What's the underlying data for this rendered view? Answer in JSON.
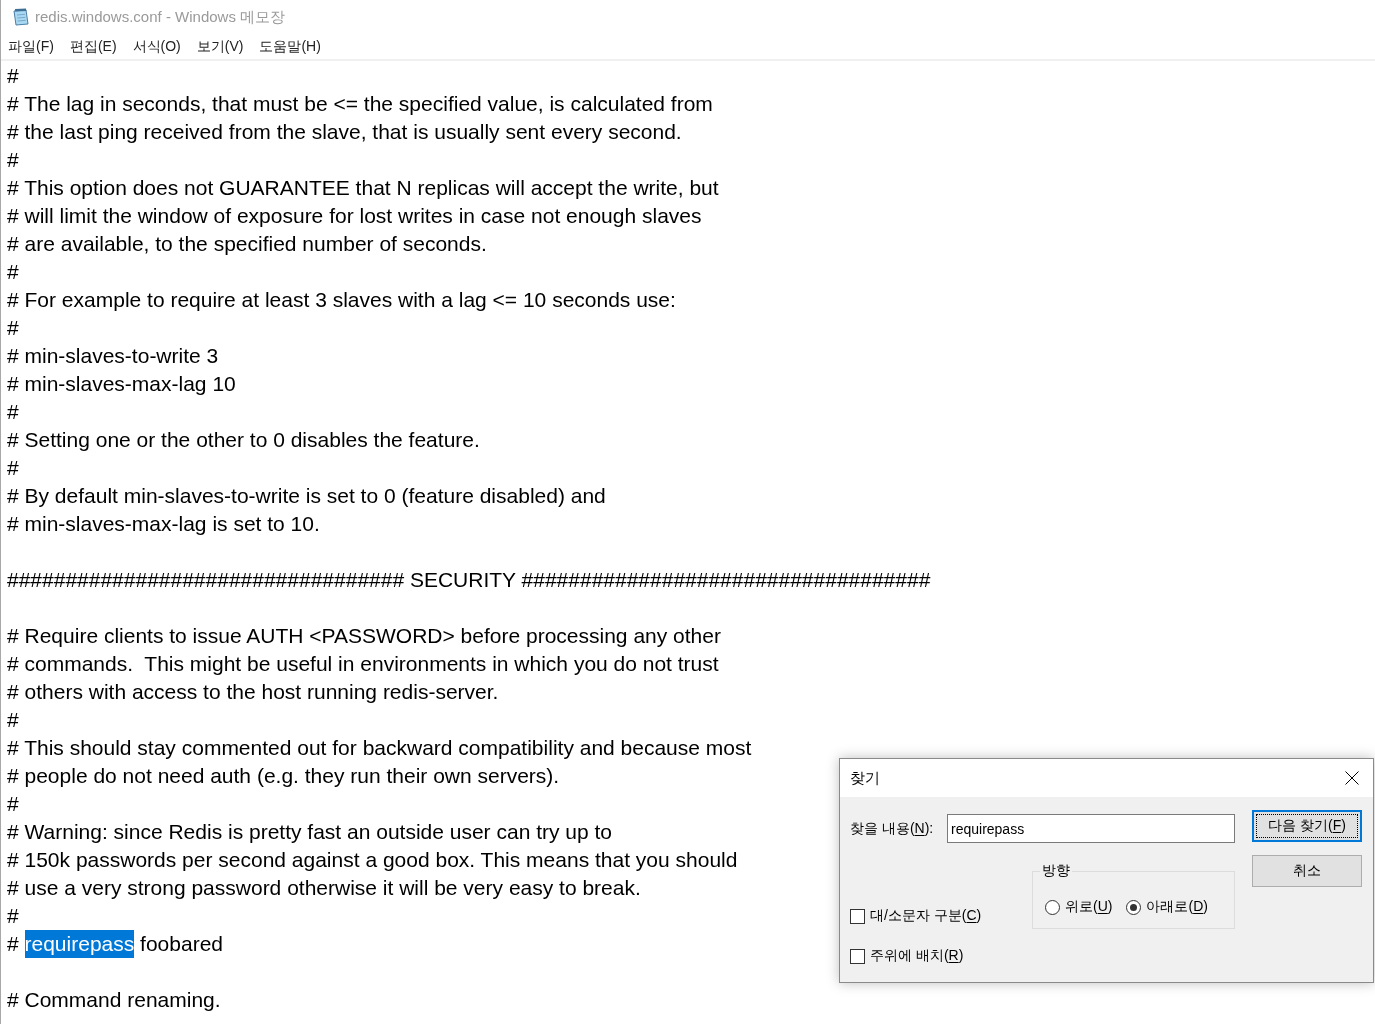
{
  "window": {
    "title": "redis.windows.conf - Windows 메모장",
    "active": false
  },
  "menu": [
    "파일(F)",
    "편집(E)",
    "서식(O)",
    "보기(V)",
    "도움말(H)"
  ],
  "editor": {
    "lines": [
      {
        "kind": "text",
        "segments": [
          {
            "text": "#",
            "selected": false
          }
        ]
      },
      {
        "kind": "text",
        "segments": [
          {
            "text": "# The lag in seconds, that must be <= the specified value, is calculated from",
            "selected": false
          }
        ]
      },
      {
        "kind": "text",
        "segments": [
          {
            "text": "# the last ping received from the slave, that is usually sent every second.",
            "selected": false
          }
        ]
      },
      {
        "kind": "text",
        "segments": [
          {
            "text": "#",
            "selected": false
          }
        ]
      },
      {
        "kind": "text",
        "segments": [
          {
            "text": "# This option does not GUARANTEE that N replicas will accept the write, but",
            "selected": false
          }
        ]
      },
      {
        "kind": "text",
        "segments": [
          {
            "text": "# will limit the window of exposure for lost writes in case not enough slaves",
            "selected": false
          }
        ]
      },
      {
        "kind": "text",
        "segments": [
          {
            "text": "# are available, to the specified number of seconds.",
            "selected": false
          }
        ]
      },
      {
        "kind": "text",
        "segments": [
          {
            "text": "#",
            "selected": false
          }
        ]
      },
      {
        "kind": "text",
        "segments": [
          {
            "text": "# For example to require at least 3 slaves with a lag <= 10 seconds use:",
            "selected": false
          }
        ]
      },
      {
        "kind": "text",
        "segments": [
          {
            "text": "#",
            "selected": false
          }
        ]
      },
      {
        "kind": "text",
        "segments": [
          {
            "text": "# min-slaves-to-write 3",
            "selected": false
          }
        ]
      },
      {
        "kind": "text",
        "segments": [
          {
            "text": "# min-slaves-max-lag 10",
            "selected": false
          }
        ]
      },
      {
        "kind": "text",
        "segments": [
          {
            "text": "#",
            "selected": false
          }
        ]
      },
      {
        "kind": "text",
        "segments": [
          {
            "text": "# Setting one or the other to 0 disables the feature.",
            "selected": false
          }
        ]
      },
      {
        "kind": "text",
        "segments": [
          {
            "text": "#",
            "selected": false
          }
        ]
      },
      {
        "kind": "text",
        "segments": [
          {
            "text": "# By default min-slaves-to-write is set to 0 (feature disabled) and",
            "selected": false
          }
        ]
      },
      {
        "kind": "text",
        "segments": [
          {
            "text": "# min-slaves-max-lag is set to 10.",
            "selected": false
          }
        ]
      },
      {
        "kind": "blank"
      },
      {
        "kind": "text",
        "segments": [
          {
            "text": "################################## SECURITY ###################################",
            "selected": false
          }
        ]
      },
      {
        "kind": "blank"
      },
      {
        "kind": "text",
        "segments": [
          {
            "text": "# Require clients to issue AUTH <PASSWORD> before processing any other",
            "selected": false
          }
        ]
      },
      {
        "kind": "text",
        "segments": [
          {
            "text": "# commands.  This might be useful in environments in which you do not trust",
            "selected": false
          }
        ]
      },
      {
        "kind": "text",
        "segments": [
          {
            "text": "# others with access to the host running redis-server.",
            "selected": false
          }
        ]
      },
      {
        "kind": "text",
        "segments": [
          {
            "text": "#",
            "selected": false
          }
        ]
      },
      {
        "kind": "text",
        "segments": [
          {
            "text": "# This should stay commented out for backward compatibility and because most",
            "selected": false
          }
        ]
      },
      {
        "kind": "text",
        "segments": [
          {
            "text": "# people do not need auth (e.g. they run their own servers).",
            "selected": false
          }
        ]
      },
      {
        "kind": "text",
        "segments": [
          {
            "text": "#",
            "selected": false
          }
        ]
      },
      {
        "kind": "text",
        "segments": [
          {
            "text": "# Warning: since Redis is pretty fast an outside user can try up to",
            "selected": false
          }
        ]
      },
      {
        "kind": "text",
        "segments": [
          {
            "text": "# 150k passwords per second against a good box. This means that you should",
            "selected": false
          }
        ]
      },
      {
        "kind": "text",
        "segments": [
          {
            "text": "# use a very strong password otherwise it will be very easy to break.",
            "selected": false
          }
        ]
      },
      {
        "kind": "text",
        "segments": [
          {
            "text": "#",
            "selected": false
          }
        ]
      },
      {
        "kind": "text",
        "segments": [
          {
            "text": "# ",
            "selected": false
          },
          {
            "text": "requirepass",
            "selected": true
          },
          {
            "text": " foobared",
            "selected": false
          }
        ]
      },
      {
        "kind": "blank"
      },
      {
        "kind": "text",
        "segments": [
          {
            "text": "# Command renaming.",
            "selected": false
          }
        ]
      }
    ]
  },
  "find_dialog": {
    "title": "찾기",
    "find_what": {
      "label": [
        {
          "text": "찾을 내용(",
          "underline": false
        },
        {
          "text": "N",
          "underline": true
        },
        {
          "text": "):",
          "underline": false
        }
      ],
      "value": "requirepass"
    },
    "direction": {
      "label": "방향",
      "options": [
        {
          "label": [
            {
              "text": "위로(",
              "underline": false
            },
            {
              "text": "U",
              "underline": true
            },
            {
              "text": ")",
              "underline": false
            }
          ],
          "selected": false
        },
        {
          "label": [
            {
              "text": "아래로(",
              "underline": false
            },
            {
              "text": "D",
              "underline": true
            },
            {
              "text": ")",
              "underline": false
            }
          ],
          "selected": true
        }
      ]
    },
    "options": [
      {
        "label": [
          {
            "text": "대/소문자 구분(",
            "underline": false
          },
          {
            "text": "C",
            "underline": true
          },
          {
            "text": ")",
            "underline": false
          }
        ],
        "checked": false
      },
      {
        "label": [
          {
            "text": "주위에 배치(",
            "underline": false
          },
          {
            "text": "R",
            "underline": true
          },
          {
            "text": ")",
            "underline": false
          }
        ],
        "checked": false
      }
    ],
    "buttons": [
      {
        "label": [
          {
            "text": "다음 찾기(",
            "underline": false
          },
          {
            "text": "F",
            "underline": true
          },
          {
            "text": ")",
            "underline": false
          }
        ],
        "focused": true
      },
      {
        "label": [
          {
            "text": "취소",
            "underline": false
          }
        ],
        "focused": false
      }
    ]
  }
}
